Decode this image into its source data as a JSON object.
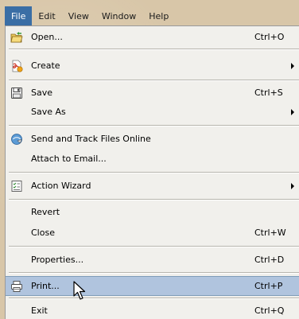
{
  "menubar": {
    "items": [
      {
        "label": "File"
      },
      {
        "label": "Edit"
      },
      {
        "label": "View"
      },
      {
        "label": "Window"
      },
      {
        "label": "Help"
      }
    ]
  },
  "menu": {
    "open": {
      "label": "Open...",
      "shortcut": "Ctrl+O",
      "icon": "open-folder-icon"
    },
    "create": {
      "label": "Create",
      "icon": "create-pdf-icon"
    },
    "save": {
      "label": "Save",
      "shortcut": "Ctrl+S",
      "icon": "save-disk-icon"
    },
    "save_as": {
      "label": "Save As"
    },
    "send_track": {
      "label": "Send and Track Files Online",
      "icon": "send-track-icon"
    },
    "attach_email": {
      "label": "Attach to Email..."
    },
    "action_wizard": {
      "label": "Action Wizard",
      "icon": "action-wizard-icon"
    },
    "revert": {
      "label": "Revert"
    },
    "close": {
      "label": "Close",
      "shortcut": "Ctrl+W"
    },
    "properties": {
      "label": "Properties...",
      "shortcut": "Ctrl+D"
    },
    "print": {
      "label": "Print...",
      "shortcut": "Ctrl+P",
      "icon": "printer-icon"
    },
    "exit": {
      "label": "Exit",
      "shortcut": "Ctrl+Q"
    }
  },
  "colors": {
    "menubar_active": "#3a6ea5",
    "menu_background": "#f1f0ec",
    "highlight": "#b0c4de"
  }
}
